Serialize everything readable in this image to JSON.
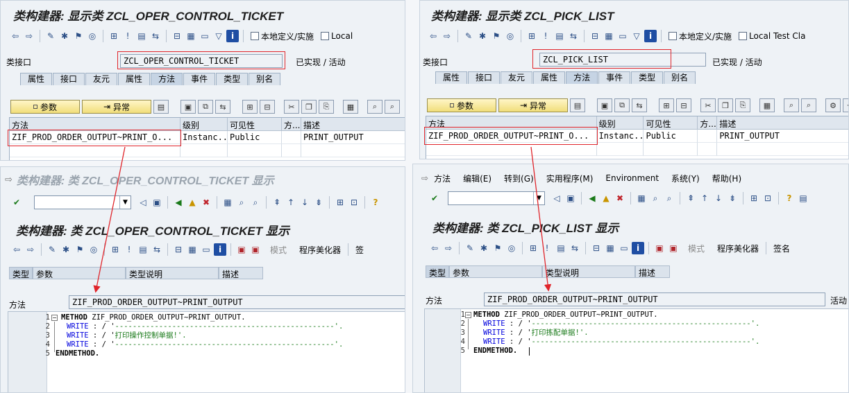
{
  "panes": {
    "tl": {
      "title": "类构建器: 显示类 ZCL_OPER_CONTROL_TICKET",
      "toolbar_local_def": "本地定义/实施",
      "toolbar_local": "Local",
      "class_iface_label": "类接口",
      "class_iface_value": "ZCL_OPER_CONTROL_TICKET",
      "status": "已实现 / 活动",
      "tabs": [
        "属性",
        "接口",
        "友元",
        "属性",
        "方法",
        "事件",
        "类型",
        "别名"
      ],
      "btn_params": "参数",
      "btn_exceptions": "异常",
      "grid_headers": [
        "方法",
        "级别",
        "可见性",
        "方...",
        "描述"
      ],
      "grid_row": [
        "ZIF_PROD_ORDER_OUTPUT~PRINT_O...",
        "Instanc...",
        "Public",
        "",
        "PRINT_OUTPUT"
      ]
    },
    "tr": {
      "title": "类构建器: 显示类 ZCL_PICK_LIST",
      "toolbar_local_def": "本地定义/实施",
      "toolbar_local": "Local Test Cla",
      "class_iface_label": "类接口",
      "class_iface_value": "ZCL_PICK_LIST",
      "status": "已实现 / 活动",
      "tabs": [
        "属性",
        "接口",
        "友元",
        "属性",
        "方法",
        "事件",
        "类型",
        "别名"
      ],
      "btn_params": "参数",
      "btn_exceptions": "异常",
      "grid_headers": [
        "方法",
        "级别",
        "可见性",
        "方...",
        "描述"
      ],
      "grid_row": [
        "ZIF_PROD_ORDER_OUTPUT~PRINT_O...",
        "Instanc...",
        "Public",
        "",
        "PRINT_OUTPUT"
      ]
    },
    "bl": {
      "window_title": "类构建器: 类 ZCL_OPER_CONTROL_TICKET 显示",
      "title": "类构建器: 类 ZCL_OPER_CONTROL_TICKET 显示",
      "mode_label": "模式",
      "pretty_printer": "程序美化器",
      "sign_label": "签",
      "sub_headers": [
        "类型",
        "参数",
        "类型说明",
        "描述"
      ],
      "method_label": "方法",
      "method_value": "ZIF_PROD_ORDER_OUTPUT~PRINT_OUTPUT",
      "code": {
        "l1_a": "METHOD",
        "l1_b": " ZIF_PROD_ORDER_OUTPUT~PRINT_OUTPUT.",
        "l2_kw": "WRITE",
        "l2_rest": " : / '",
        "l2_str": "--------------------------------------------------",
        "l2_end": "'.",
        "l3_kw": "WRITE",
        "l3_rest": " : / '",
        "l3_str": "打印操作控制单据!",
        "l3_end": "'.",
        "l4_kw": "WRITE",
        "l4_rest": " : / '",
        "l4_str": "--------------------------------------------------",
        "l4_end": "'.",
        "l5": "ENDMETHOD."
      }
    },
    "br": {
      "menu": [
        "方法",
        "编辑(E)",
        "转到(G)",
        "实用程序(M)",
        "Environment",
        "系统(Y)",
        "帮助(H)"
      ],
      "title": "类构建器: 类 ZCL_PICK_LIST 显示",
      "mode_label": "模式",
      "pretty_printer": "程序美化器",
      "sign_label": "签名",
      "sub_headers": [
        "类型",
        "参数",
        "类型说明",
        "描述"
      ],
      "method_label": "方法",
      "method_value": "ZIF_PROD_ORDER_OUTPUT~PRINT_OUTPUT",
      "active_label": "活动",
      "code": {
        "l1_a": "METHOD",
        "l1_b": " ZIF_PROD_ORDER_OUTPUT~PRINT_OUTPUT.",
        "l2_kw": "WRITE",
        "l2_rest": " : / '",
        "l2_str": "--------------------------------------------------",
        "l2_end": "'.",
        "l3_kw": "WRITE",
        "l3_rest": " : / '",
        "l3_str": "打印拣配单据!",
        "l3_end": "'.",
        "l4_kw": "WRITE",
        "l4_rest": " : / '",
        "l4_str": "--------------------------------------------------",
        "l4_end": "'.",
        "l5": "ENDMETHOD."
      }
    }
  },
  "line_numbers": [
    "1",
    "2",
    "3",
    "4",
    "5"
  ],
  "colors": {
    "annotation_red": "#e0242a",
    "keyword_blue": "#0000dd",
    "string_green": "#1a7a1a"
  }
}
